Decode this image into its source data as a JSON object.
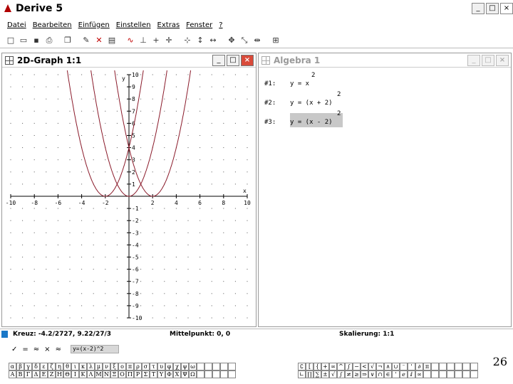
{
  "app": {
    "title": "Derive 5"
  },
  "menu": [
    "Datei",
    "Bearbeiten",
    "Einfügen",
    "Einstellen",
    "Extras",
    "Fenster",
    "?"
  ],
  "toolbar_icons": [
    "new-file-icon",
    "open-folder-icon",
    "save-icon",
    "print-icon",
    "copy-window-icon",
    "brush-icon",
    "delete-icon",
    "edit-note-icon",
    "plot-icon",
    "axes-icon",
    "cross-icon",
    "move-cross-icon",
    "center-icon",
    "zoom-horizontal-icon",
    "zoom-both-icon",
    "zoom-vertical-icon",
    "zoom-out-icon",
    "grid-icon"
  ],
  "graph_window": {
    "title": "2D-Graph 1:1",
    "buttons": {
      "minimize": "_",
      "maximize": "□",
      "close": "×"
    }
  },
  "algebra_window": {
    "title": "Algebra 1",
    "expressions": [
      {
        "id": "#1:",
        "text": "y = x",
        "exponent": "2",
        "selected": false
      },
      {
        "id": "#2:",
        "text": "y = (x + 2)",
        "exponent": "2",
        "selected": false
      },
      {
        "id": "#3:",
        "text": "y = (x - 2)",
        "exponent": "2",
        "selected": true
      }
    ]
  },
  "chart_data": {
    "type": "line",
    "title": "",
    "xlabel": "x",
    "ylabel": "y",
    "xlim": [
      -10,
      10
    ],
    "ylim": [
      -10,
      10
    ],
    "x_ticks": [
      -10,
      -8,
      -6,
      -4,
      -2,
      2,
      4,
      6,
      8,
      10
    ],
    "y_ticks": [
      -10,
      -9,
      -8,
      -7,
      -6,
      -5,
      -4,
      -3,
      -2,
      -1,
      1,
      2,
      3,
      4,
      5,
      6,
      7,
      8,
      9,
      10
    ],
    "grid": true,
    "series": [
      {
        "expr": "x^2",
        "shift": 0,
        "color": "#8a1a2a",
        "dashed": false
      },
      {
        "expr": "(x+2)^2",
        "shift": -2,
        "color": "#8a1a2a",
        "dashed": false
      },
      {
        "expr": "(x-2)^2",
        "shift": 2,
        "color": "#8a1a2a",
        "dashed": false
      }
    ]
  },
  "status": {
    "cursor": "Kreuz: -4.2/2727, 9.22/27/3",
    "center": "Mittelpunkt: 0, 0",
    "scale": "Skalierung: 1:1"
  },
  "entry": {
    "value": "y=(x-2)^2",
    "buttons": [
      "✓",
      "=",
      "≈",
      "×",
      "≈"
    ]
  },
  "greek_row1": [
    "α",
    "β",
    "γ",
    "δ",
    "ε",
    "ζ",
    "η",
    "θ",
    "ι",
    "κ",
    "λ",
    "μ",
    "ν",
    "ξ",
    "ο",
    "π",
    "ρ",
    "σ",
    "τ",
    "υ",
    "φ",
    "χ",
    "ψ",
    "ω",
    "",
    "",
    "",
    "",
    ""
  ],
  "greek_row2": [
    "Α",
    "Β",
    "Γ",
    "Δ",
    "Ε",
    "Ζ",
    "Η",
    "Θ",
    "Ι",
    "Κ",
    "Λ",
    "Μ",
    "Ν",
    "Ξ",
    "Ο",
    "Π",
    "Ρ",
    "Σ",
    "Τ",
    "Υ",
    "Φ",
    "Χ",
    "Ψ",
    "Ω",
    "",
    "",
    "",
    "",
    ""
  ],
  "math_row1": [
    "∁",
    "[",
    "{",
    "+",
    "∞",
    "^",
    "∫",
    "−",
    "<",
    "√",
    "¬",
    "∧",
    "∪",
    "⁻",
    "'",
    "∂",
    "π",
    "",
    "",
    "",
    "",
    "",
    ""
  ],
  "math_row2": [
    "∟",
    "∏",
    "∑",
    "±",
    "√",
    "∫",
    "≠",
    "≥",
    "⇒",
    "∨",
    "∩",
    "∈",
    "'",
    "ℯ",
    "ⅈ",
    "∞",
    "",
    "",
    "",
    "",
    "",
    "",
    ""
  ],
  "page_number": "26"
}
